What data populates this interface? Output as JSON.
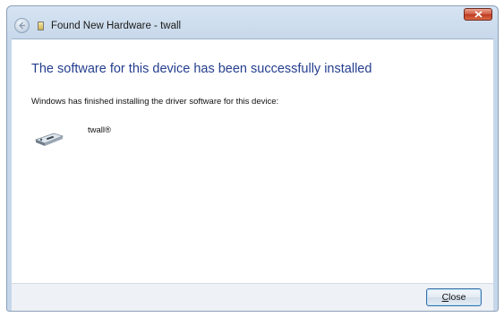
{
  "window": {
    "title": "Found New Hardware - twall"
  },
  "main": {
    "heading": "The software for this device has been successfully installed",
    "description": "Windows has finished installing the driver software for this device:",
    "device_name": "twall®"
  },
  "footer": {
    "close_label_mnemonic": "C",
    "close_label_rest": "lose"
  },
  "icons": {
    "back": "back-arrow-icon",
    "title": "hardware-icon",
    "close": "close-icon",
    "device": "device-icon"
  },
  "colors": {
    "heading": "#243e8e",
    "titlebar": "#c6d7ea",
    "close_button": "#c9432b"
  }
}
